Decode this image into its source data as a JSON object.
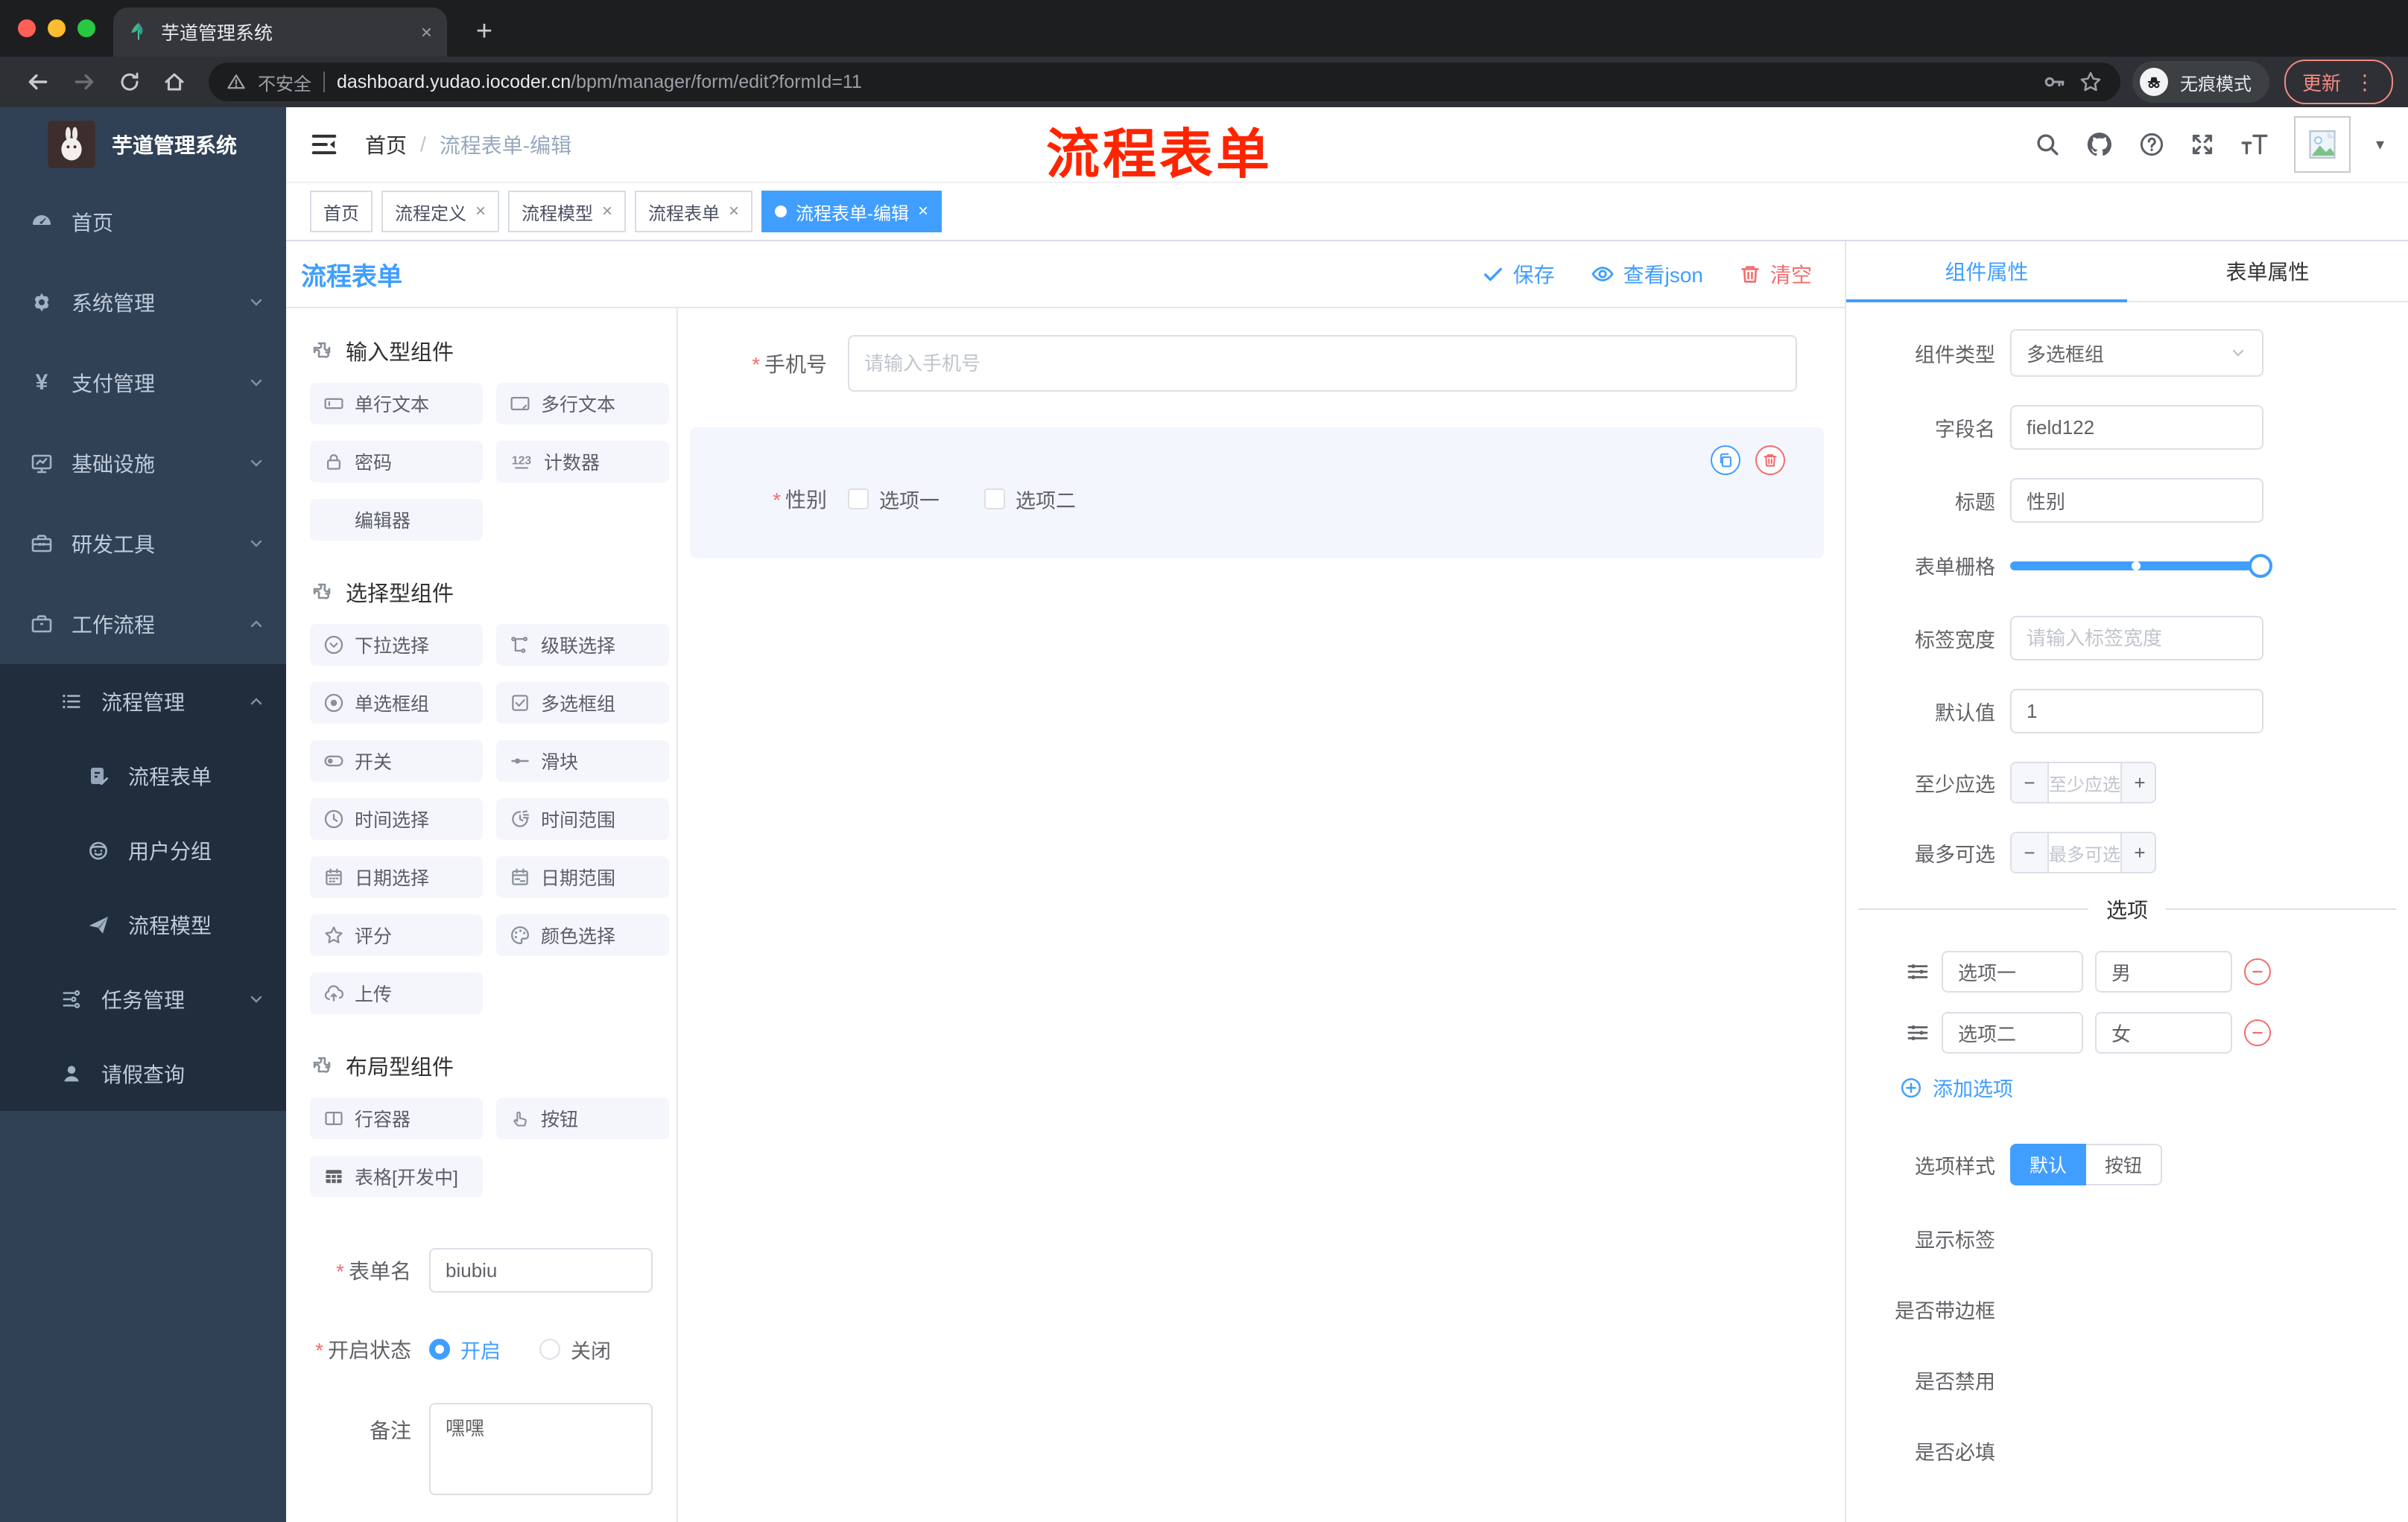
{
  "browser": {
    "tab_title": "芋道管理系统",
    "security": "不安全",
    "host": "dashboard.yudao.iocoder.cn",
    "path": "/bpm/manager/form/edit?formId=11",
    "incognito": "无痕模式",
    "update": "更新"
  },
  "annotation": {
    "text": "流程表单"
  },
  "ui": {
    "close": "×",
    "required": "*",
    "slash": "/",
    "minus": "−",
    "plus": "+",
    "caret": "▾",
    "menu_dots": "⋮",
    "new_tab": "+"
  },
  "icons": {
    "counter": "123",
    "star": "☆"
  },
  "sidebar": {
    "app_title": "芋道管理系统",
    "home": "首页",
    "system": "系统管理",
    "pay": "支付管理",
    "infra": "基础设施",
    "dev": "研发工具",
    "workflow": "工作流程",
    "process_mgmt": "流程管理",
    "process_form": "流程表单",
    "user_group": "用户分组",
    "process_model": "流程模型",
    "task_mgmt": "任务管理",
    "leave_query": "请假查询"
  },
  "breadcrumb": {
    "home": "首页",
    "current": "流程表单-编辑"
  },
  "tabs": {
    "t0": "首页",
    "t1": "流程定义",
    "t2": "流程模型",
    "t3": "流程表单",
    "t4": "流程表单-编辑"
  },
  "designer": {
    "panel_title": "流程表单",
    "toolbar": {
      "save": "保存",
      "view_json": "查看json",
      "clear": "清空"
    },
    "groups": {
      "input": "输入型组件",
      "select": "选择型组件",
      "layout": "布局型组件"
    },
    "palette_input": [
      "单行文本",
      "多行文本",
      "密码",
      "计数器",
      "编辑器"
    ],
    "palette_select": [
      "下拉选择",
      "级联选择",
      "单选框组",
      "多选框组",
      "开关",
      "滑块",
      "时间选择",
      "时间范围",
      "日期选择",
      "日期范围",
      "评分",
      "颜色选择",
      "上传"
    ],
    "palette_layout": [
      "行容器",
      "按钮",
      "表格[开发中]"
    ],
    "meta": {
      "name_label": "表单名",
      "name_value": "biubiu",
      "status_label": "开启状态",
      "status_on": "开启",
      "status_off": "关闭",
      "remark_label": "备注",
      "remark_value": "嘿嘿"
    },
    "canvas": {
      "phone_label": "手机号",
      "phone_placeholder": "请输入手机号",
      "gender_label": "性别",
      "gender_opt1": "选项一",
      "gender_opt2": "选项二"
    }
  },
  "props": {
    "tab_component": "组件属性",
    "tab_form": "表单属性",
    "type_label": "组件类型",
    "type_value": "多选框组",
    "field_label": "字段名",
    "field_value": "field122",
    "title_label": "标题",
    "title_value": "性别",
    "grid_label": "表单栅格",
    "width_label": "标签宽度",
    "width_placeholder": "请输入标签宽度",
    "default_label": "默认值",
    "default_value": "1",
    "min_label": "至少应选",
    "min_placeholder": "至少应选",
    "max_label": "最多可选",
    "max_placeholder": "最多可选",
    "options_title": "选项",
    "options": [
      {
        "label": "选项一",
        "value": "男"
      },
      {
        "label": "选项二",
        "value": "女"
      }
    ],
    "add_option": "添加选项",
    "style_label": "选项样式",
    "style_default": "默认",
    "style_button": "按钮",
    "show_label": "显示标签",
    "border_label": "是否带边框",
    "disabled_label": "是否禁用",
    "required_label": "是否必填"
  }
}
